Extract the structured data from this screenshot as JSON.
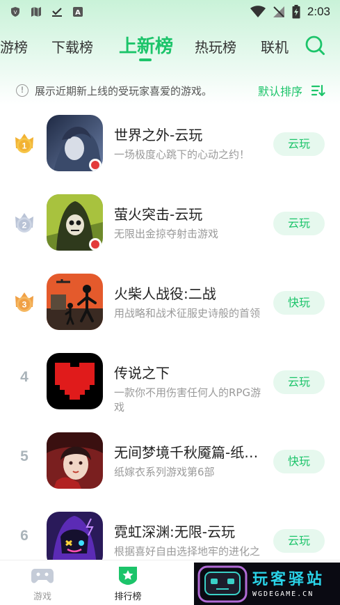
{
  "status_bar": {
    "time": "2:03",
    "left_icons": [
      "shield-icon",
      "map-icon",
      "download-done-icon",
      "font-a-icon"
    ],
    "right_icons": [
      "wifi-icon",
      "signal-off-icon",
      "battery-charging-icon"
    ]
  },
  "tabs": [
    {
      "label": "游榜",
      "active": false
    },
    {
      "label": "下载榜",
      "active": false
    },
    {
      "label": "上新榜",
      "active": true
    },
    {
      "label": "热玩榜",
      "active": false
    },
    {
      "label": "联机",
      "active": false
    }
  ],
  "info": {
    "text": "展示近期新上线的受玩家喜爱的游戏。",
    "sort_label": "默认排序"
  },
  "games": [
    {
      "rank": "1",
      "name": "世界之外-云玩",
      "desc": "一场极度心跳下的心动之约！",
      "action": "云玩"
    },
    {
      "rank": "2",
      "name": "萤火突击-云玩",
      "desc": "无限出金掠夺射击游戏",
      "action": "云玩"
    },
    {
      "rank": "3",
      "name": "火柴人战役:二战",
      "desc": "用战略和战术征服史诗般的首领",
      "action": "快玩"
    },
    {
      "rank": "4",
      "name": "传说之下",
      "desc": "一款你不用伤害任何人的RPG游戏",
      "action": "云玩"
    },
    {
      "rank": "5",
      "name": "无间梦境千秋魇篇-纸嫁衣",
      "desc": "纸嫁衣系列游戏第6部",
      "action": "快玩"
    },
    {
      "rank": "6",
      "name": "霓虹深渊:无限-云玩",
      "desc": "根据喜好自由选择地牢的进化之路~",
      "action": "云玩"
    }
  ],
  "bottom_nav": [
    {
      "label": "游戏",
      "icon": "gamepad-icon",
      "active": false
    },
    {
      "label": "排行榜",
      "icon": "ranking-icon",
      "active": true
    }
  ],
  "watermark": {
    "title": "玩客驿站",
    "subtitle": "WGDEGAME.CN"
  },
  "colors": {
    "accent": "#1cc46a",
    "button_bg": "#e6f8ee",
    "gold": "#f2b233",
    "silver": "#b9c3d6",
    "bronze": "#f0a045"
  }
}
